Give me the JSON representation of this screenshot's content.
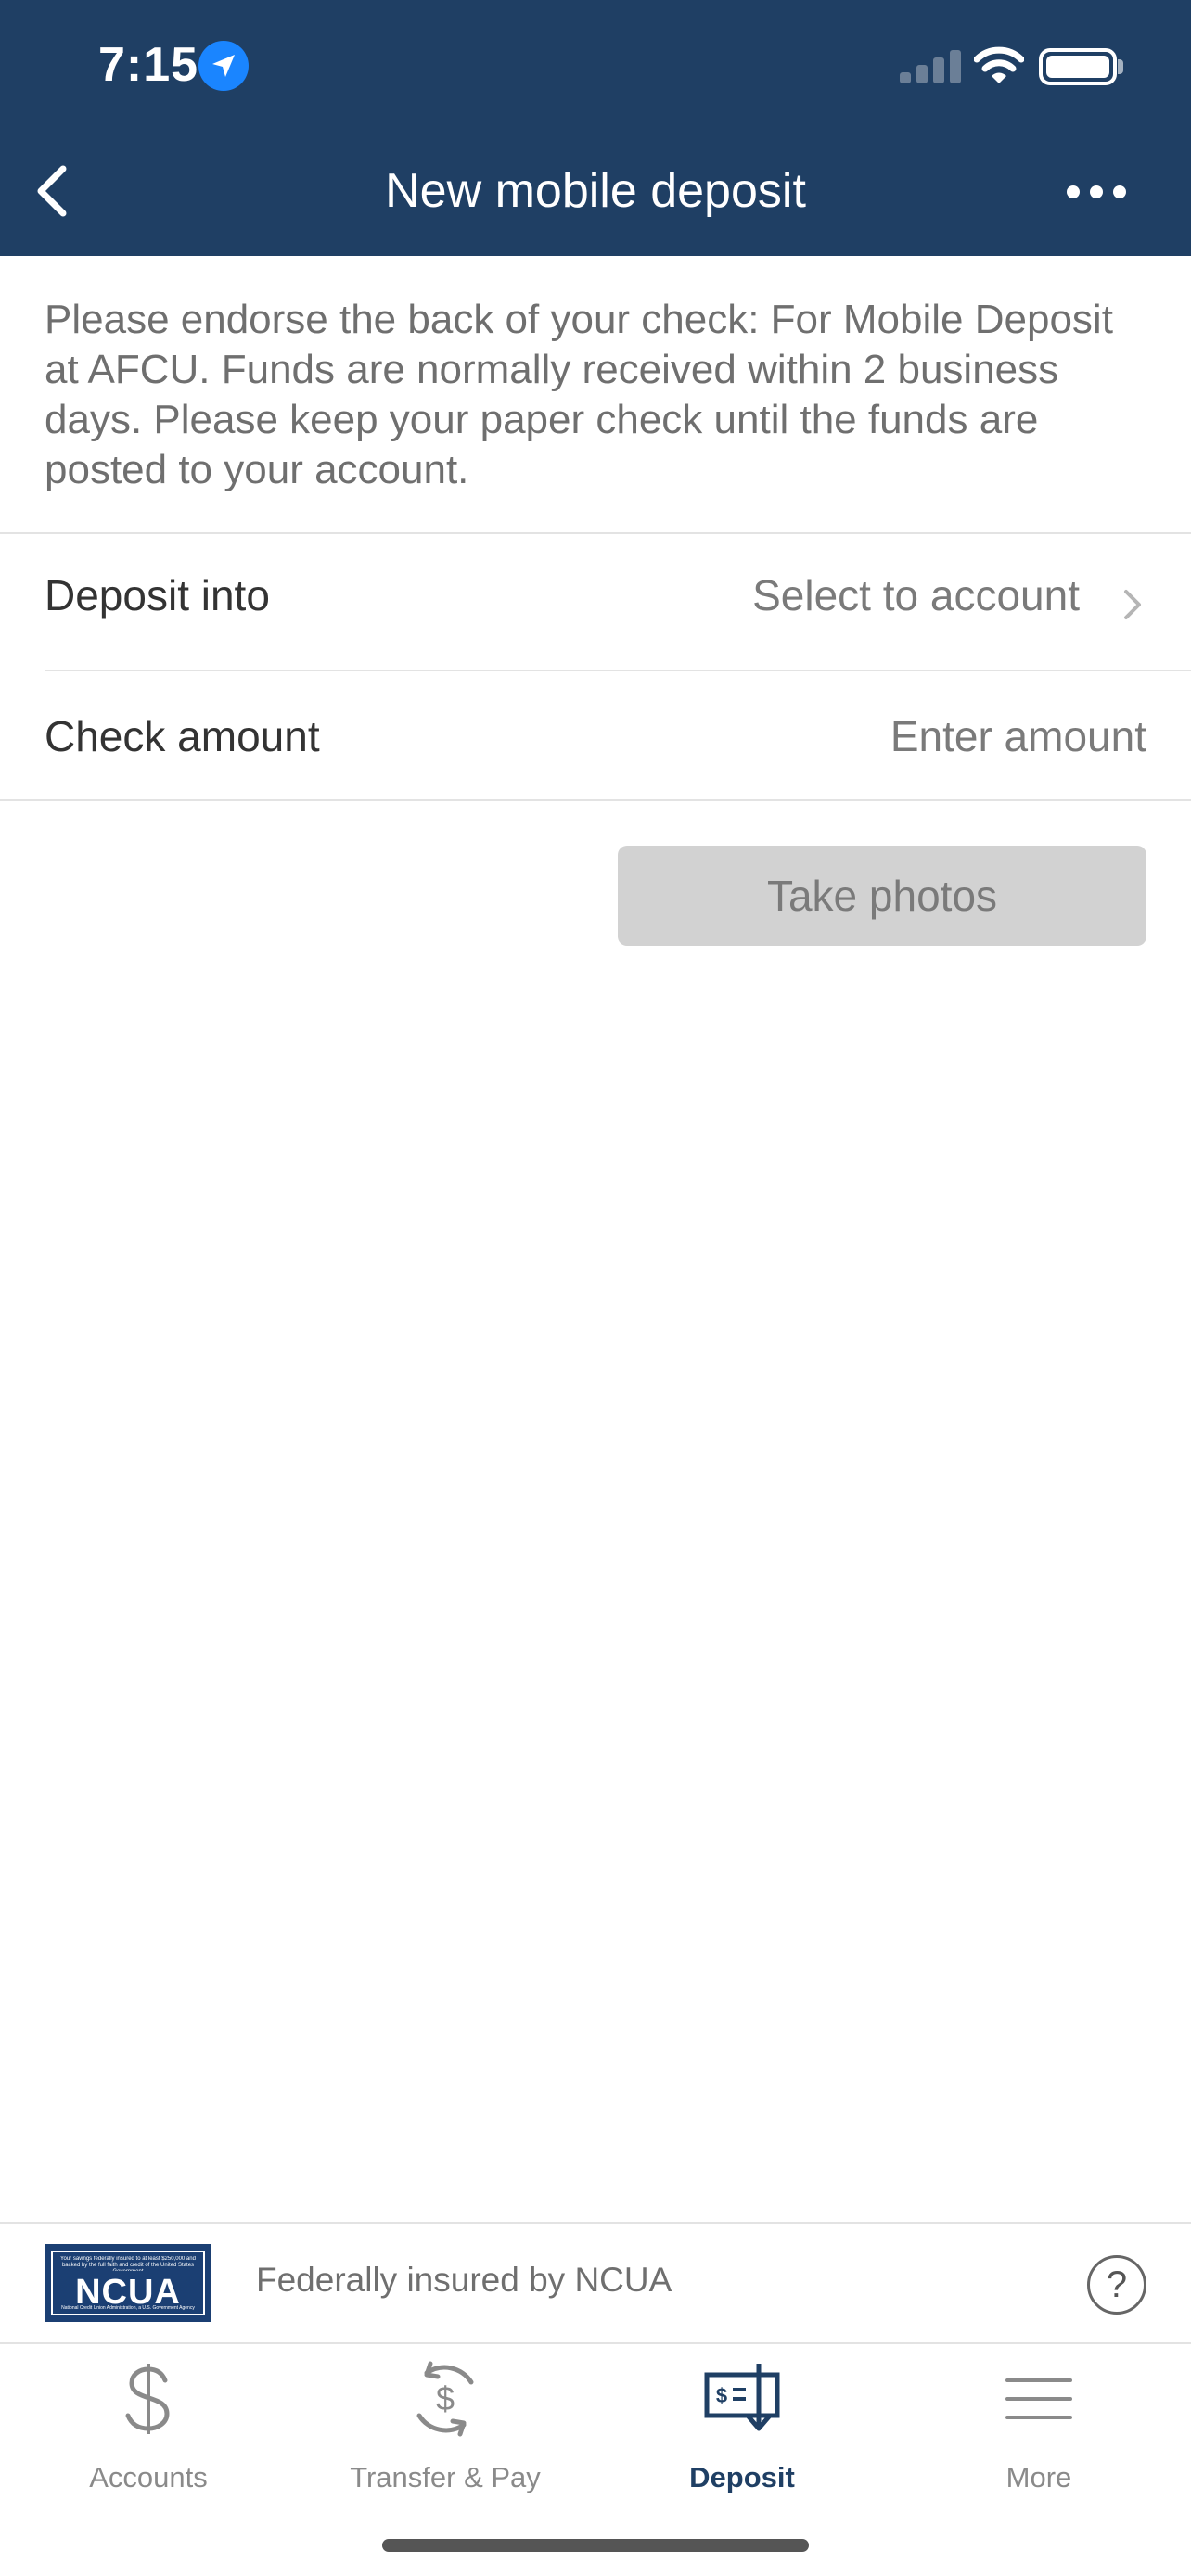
{
  "status_bar": {
    "time": "7:15",
    "location_icon": "location-arrow-icon",
    "signal_icon": "cellular-signal-icon",
    "wifi_icon": "wifi-icon",
    "battery_icon": "battery-icon"
  },
  "nav": {
    "title": "New mobile deposit",
    "back_icon": "chevron-left-icon",
    "more_icon": "ellipsis-icon"
  },
  "instructions": "Please endorse the back of your check: For Mobile Deposit at AFCU. Funds are normally received within 2 business days. Please keep your paper check until the funds are posted to your account.",
  "form": {
    "deposit_into": {
      "label": "Deposit into",
      "value": "Select to account"
    },
    "check_amount": {
      "label": "Check amount",
      "placeholder": "Enter amount"
    },
    "take_photos_label": "Take photos"
  },
  "footer": {
    "ncua_logo_text": "NCUA",
    "ncua_logo_fine_print_top": "Your savings federally insured to at least $250,000 and backed by the full faith and credit of the United States Government",
    "ncua_logo_fine_print_bottom": "National Credit Union Administration, a U.S. Government Agency",
    "insured_text": "Federally insured by NCUA",
    "help_glyph": "?"
  },
  "tab_bar": {
    "active": "Deposit",
    "items": [
      {
        "label": "Accounts",
        "icon": "dollar-icon"
      },
      {
        "label": "Transfer & Pay",
        "icon": "transfer-dollar-icon"
      },
      {
        "label": "Deposit",
        "icon": "check-deposit-icon"
      },
      {
        "label": "More",
        "icon": "menu-icon"
      }
    ]
  },
  "colors": {
    "header_bg": "#1f3f64",
    "accent": "#1f3f64",
    "location_badge": "#1a85ff",
    "button_disabled_bg": "#d2d2d2",
    "tab_inactive": "#8a8a8a",
    "ncua_blue": "#1b3f73"
  }
}
